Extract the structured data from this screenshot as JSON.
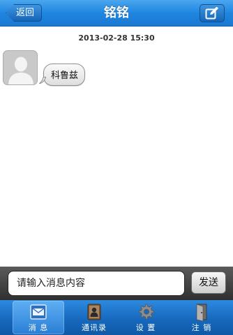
{
  "nav": {
    "back_label": "返回",
    "title": "铭铭",
    "compose_icon": "compose-icon"
  },
  "chat": {
    "timestamp": "2013-02-28 15:30",
    "messages": [
      {
        "sender": "other",
        "avatar": "default-avatar-icon",
        "text": "科鲁兹"
      }
    ]
  },
  "input": {
    "placeholder": "请输入消息内容",
    "send_label": "发送"
  },
  "tabs": [
    {
      "label": "消 息",
      "icon": "message-icon",
      "active": true
    },
    {
      "label": "通讯录",
      "icon": "contacts-icon",
      "active": false
    },
    {
      "label": "设 置",
      "icon": "gear-icon",
      "active": false
    },
    {
      "label": "注 销",
      "icon": "logout-door-icon",
      "active": false
    }
  ],
  "colors": {
    "navbar": "#1f86e0",
    "tabbar": "#1769bd",
    "inputbar": "#404040"
  }
}
